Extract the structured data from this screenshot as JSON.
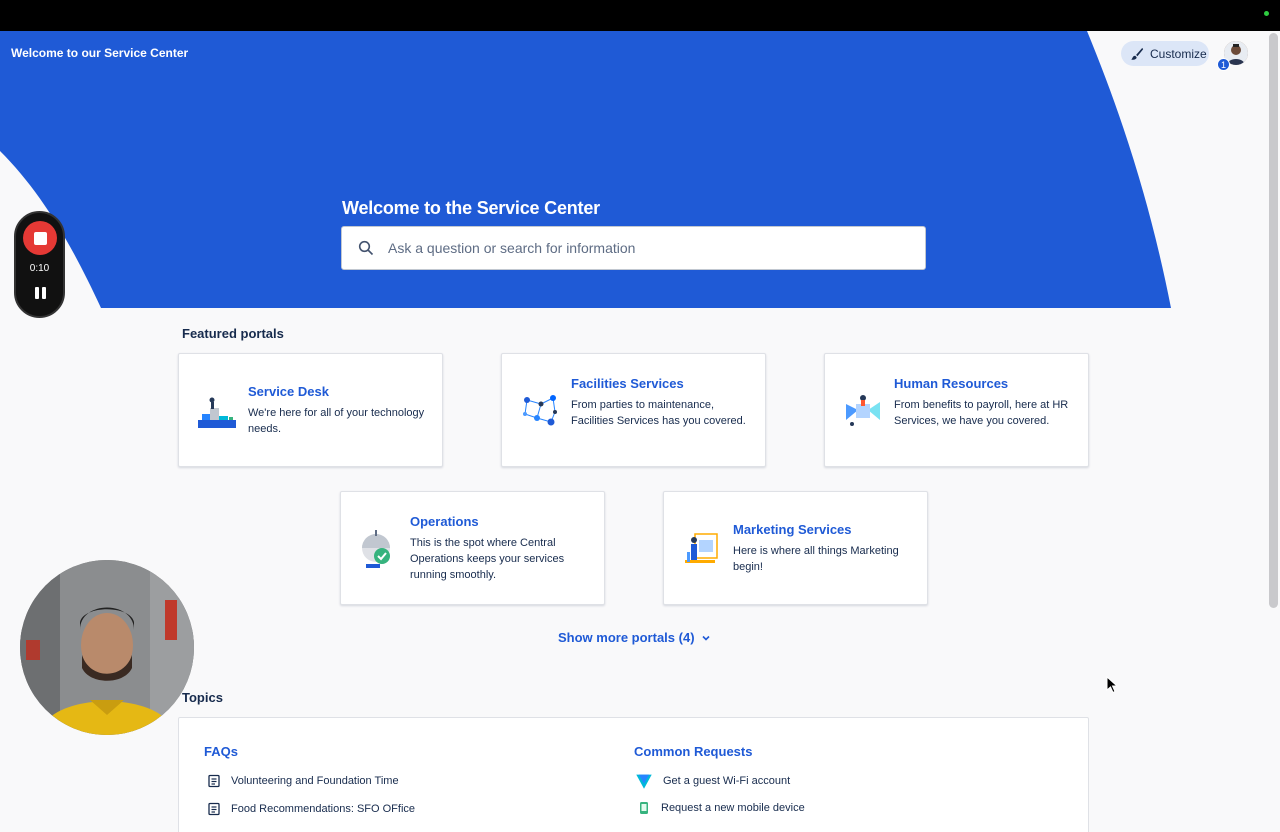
{
  "header": {
    "site_title": "Welcome to our Service Center",
    "customize_label": "Customize",
    "notification_count": "1"
  },
  "hero": {
    "title": "Welcome to the Service Center",
    "search_placeholder": "Ask a question or search for information",
    "brand_color": "#1f5ad6"
  },
  "recorder": {
    "time": "0:10"
  },
  "featured": {
    "title": "Featured portals",
    "portals": [
      {
        "name": "Service Desk",
        "description": "We're here for all of your technology needs.",
        "icon": "service-desk-icon"
      },
      {
        "name": "Facilities Services",
        "description": "From parties to maintenance, Facilities Services has you covered.",
        "icon": "facilities-icon"
      },
      {
        "name": "Human Resources",
        "description": "From benefits to payroll, here at HR Services, we have you covered.",
        "icon": "human-resources-icon"
      },
      {
        "name": "Operations",
        "description": "This is the spot where Central Operations keeps your services running smoothly.",
        "icon": "operations-icon"
      },
      {
        "name": "Marketing Services",
        "description": "Here is where all things Marketing begin!",
        "icon": "marketing-icon"
      }
    ],
    "show_more_label": "Show more portals (4)"
  },
  "topics": {
    "title": "Topics",
    "faqs": {
      "title": "FAQs",
      "items": [
        "Volunteering and Foundation Time",
        "Food Recommendations: SFO OFfice"
      ]
    },
    "common_requests": {
      "title": "Common Requests",
      "items": [
        "Get a guest Wi-Fi account",
        "Request a new mobile device"
      ]
    }
  }
}
